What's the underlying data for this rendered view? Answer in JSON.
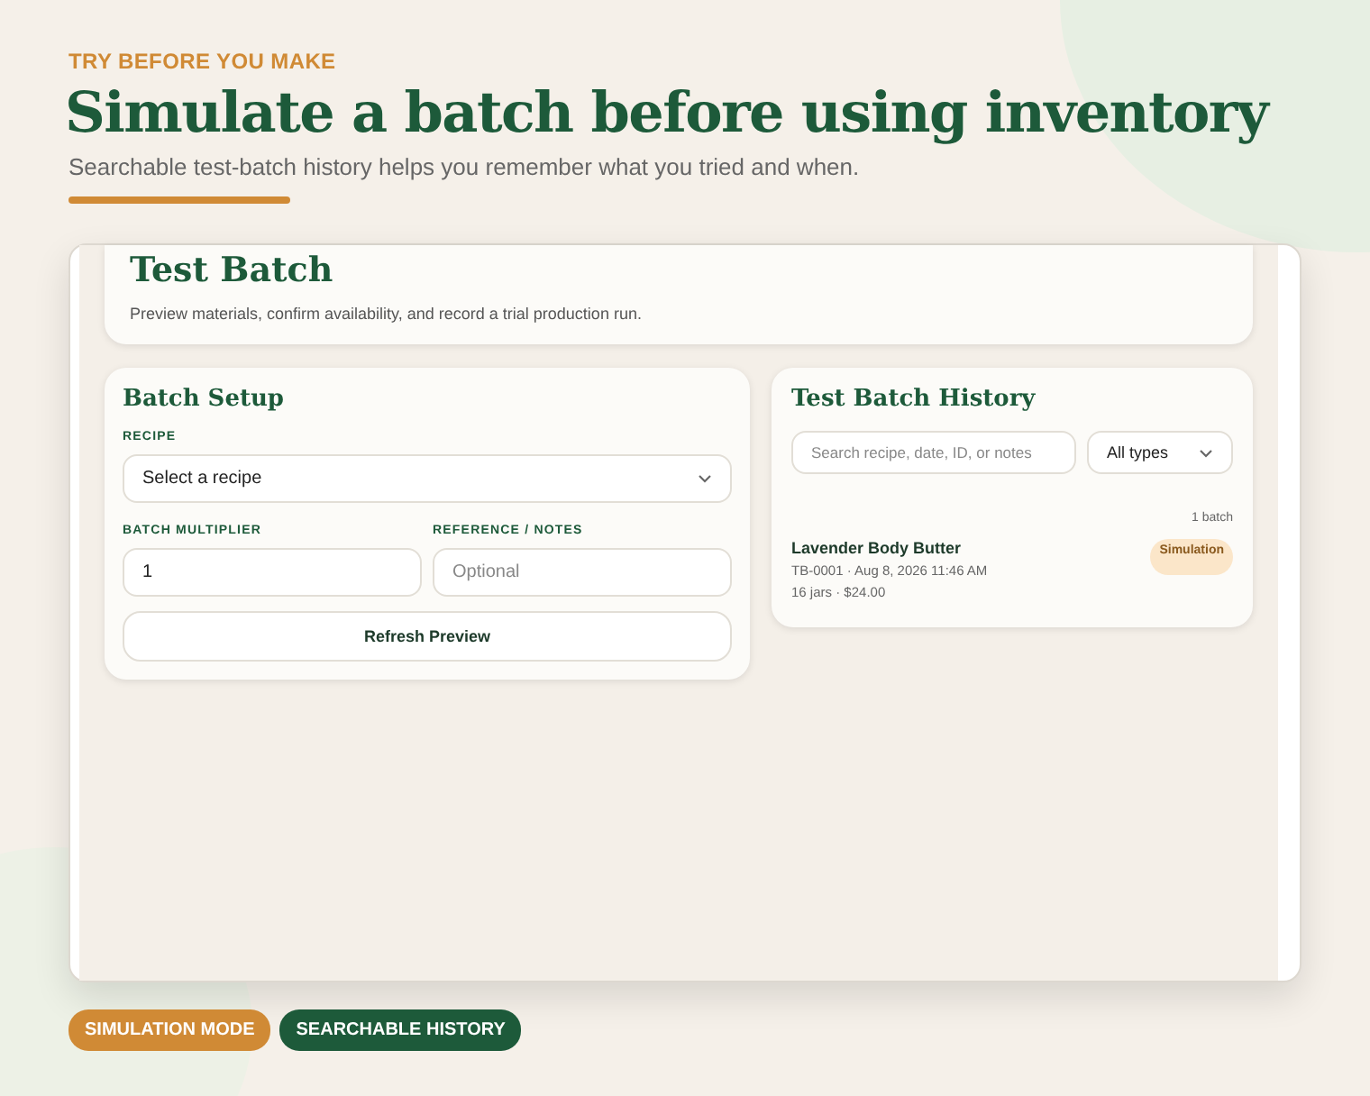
{
  "eyebrow": "TRY BEFORE YOU MAKE",
  "headline": "Simulate a batch before using inventory",
  "subtitle": "Searchable test-batch history helps you remember what you tried and when.",
  "app": {
    "title": "Test Batch",
    "description": "Preview materials, confirm availability, and record a trial production run.",
    "setup": {
      "title": "Batch Setup",
      "recipe_label": "RECIPE",
      "recipe_value": "Select a recipe",
      "multiplier_label": "BATCH MULTIPLIER",
      "multiplier_value": "1",
      "notes_label": "REFERENCE / NOTES",
      "notes_placeholder": "Optional",
      "button": "Refresh Preview"
    },
    "history": {
      "title": "Test Batch History",
      "search_placeholder": "Search recipe, date, ID, or notes",
      "filter_value": "All types",
      "count": "1 batch",
      "items": [
        {
          "name": "Lavender Body Butter",
          "meta": "TB-0001 · Aug 8, 2026 11:46 AM",
          "detail": "16 jars · $24.00",
          "badge": "Simulation"
        }
      ]
    }
  },
  "tags": [
    {
      "label": "SIMULATION MODE",
      "color": "#d08a35"
    },
    {
      "label": "SEARCHABLE HISTORY",
      "color": "#1d5a3a"
    }
  ]
}
